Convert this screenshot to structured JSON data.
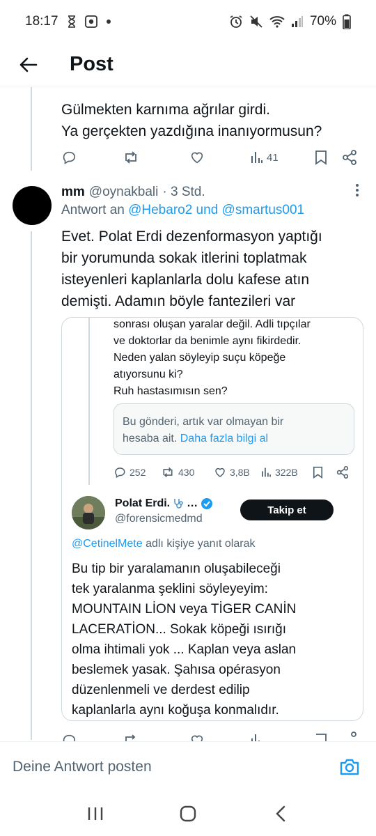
{
  "status_bar": {
    "time": "18:17",
    "battery": "70%"
  },
  "header": {
    "title": "Post"
  },
  "parent_tweet": {
    "text_line1": "Gülmekten karnıma ağrılar girdi.",
    "text_line2": "Ya gerçekten yazdığına inanıyormusun?",
    "views": "41"
  },
  "reply": {
    "name": "mm",
    "handle": "@oynakbali",
    "time": "· 3 Std.",
    "reply_to_prefix": "Antwort an ",
    "mention1": "@Hebaro2",
    "reply_to_and": " und ",
    "mention2": "@smartus001",
    "text_lines": [
      "Evet. Polat Erdi dezenformasyon yaptığı",
      "bir yorumunda sokak itlerini toplatmak",
      "isteyenleri kaplanlarla dolu kafese atın",
      "demişti. Adamın böyle fantezileri var"
    ]
  },
  "quoted": {
    "top_text_lines": [
      "sonrası oluşan yaralar değil. Adli tıpçılar",
      "ve doktorlar da benimle aynı fikirdedir.",
      "Neden yalan söyleyip suçu köpeğe",
      "atıyorsunu ki?",
      "Ruh hastasımısın sen?"
    ],
    "unavailable_line1": "Bu gönderi, artık var olmayan bir",
    "unavailable_line2_prefix": "hesaba ait. ",
    "unavailable_link": "Daha fazla bilgi al",
    "stats": {
      "replies": "252",
      "reposts": "430",
      "likes": "3,8B",
      "views": "322B"
    },
    "author_name": "Polat Erdi.",
    "author_name_suffix": "…",
    "author_handle": "@forensicmedmd",
    "follow_label": "Takip et",
    "replyto_mention": "@CetinelMete",
    "replyto_suffix": " adlı kişiye yanıt olarak",
    "body_lines": [
      "Bu tip bir yaralamanın oluşabileceği",
      "tek yaralanma şeklini söyleyeyim:",
      "MOUNTAIN LİON veya TİGER CANİN",
      "LACERATİON... Sokak köpeği ısırığı",
      "olma ihtimali yok ... Kaplan veya aslan",
      "beslemek yasak. Şahısa opérasyon",
      "düzenlenmeli ve derdest edilip",
      "kaplanlarla aynı koğuşa konmalıdır."
    ]
  },
  "composer": {
    "placeholder": "Deine Antwort posten"
  },
  "colors": {
    "accent": "#1d9bf0",
    "text": "#0f1419",
    "muted": "#536471"
  }
}
